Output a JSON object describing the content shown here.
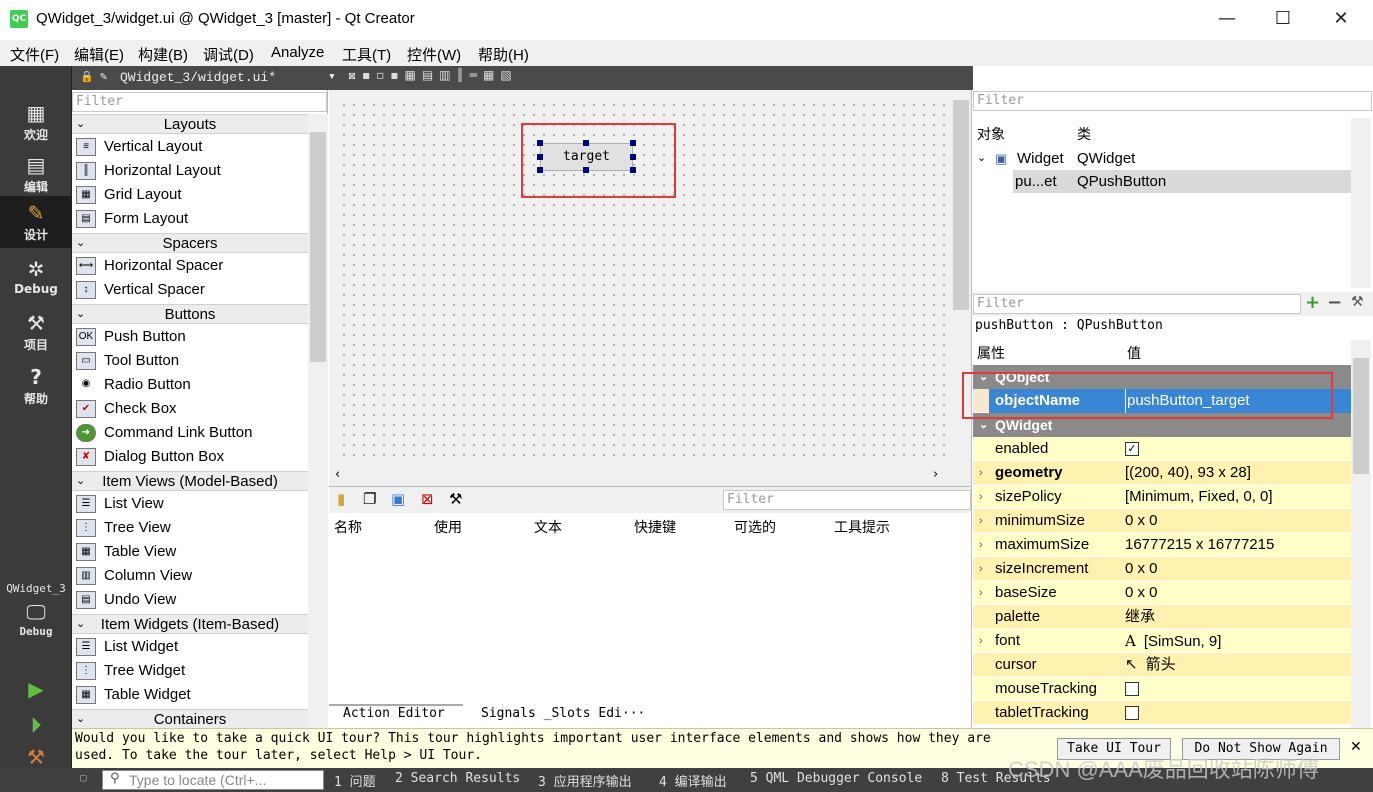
{
  "window": {
    "title": "QWidget_3/widget.ui @ QWidget_3 [master] - Qt Creator",
    "logo": "QC",
    "minimize": "—",
    "maximize": "☐",
    "close": "✕"
  },
  "menu": [
    "文件(F)",
    "编辑(E)",
    "构建(B)",
    "调试(D)",
    "Analyze",
    "工具(T)",
    "控件(W)",
    "帮助(H)"
  ],
  "modes": [
    {
      "label": "欢迎",
      "icon": "grid-icon"
    },
    {
      "label": "编辑",
      "icon": "document-icon"
    },
    {
      "label": "设计",
      "icon": "pencil-icon"
    },
    {
      "label": "Debug",
      "icon": "bug-icon"
    },
    {
      "label": "项目",
      "icon": "wrench-icon"
    },
    {
      "label": "帮助",
      "icon": "help-icon"
    }
  ],
  "kit": {
    "project": "QWidget_3",
    "config": "Debug"
  },
  "doc_tab": {
    "label": "QWidget_3/widget.ui*",
    "dropdown": "▾",
    "close": "✕"
  },
  "widget_box": {
    "filter_placeholder": "Filter",
    "categories": [
      {
        "name": "Layouts",
        "items": [
          "Vertical Layout",
          "Horizontal Layout",
          "Grid Layout",
          "Form Layout"
        ]
      },
      {
        "name": "Spacers",
        "items": [
          "Horizontal Spacer",
          "Vertical Spacer"
        ]
      },
      {
        "name": "Buttons",
        "items": [
          "Push Button",
          "Tool Button",
          "Radio Button",
          "Check Box",
          "Command Link Button",
          "Dialog Button Box"
        ]
      },
      {
        "name": "Item Views (Model-Based)",
        "items": [
          "List View",
          "Tree View",
          "Table View",
          "Column View",
          "Undo View"
        ]
      },
      {
        "name": "Item Widgets (Item-Based)",
        "items": [
          "List Widget",
          "Tree Widget",
          "Table Widget"
        ]
      },
      {
        "name": "Containers",
        "items": []
      }
    ]
  },
  "form": {
    "button_text": "target"
  },
  "action_editor": {
    "filter_placeholder": "Filter",
    "columns": [
      "名称",
      "使用",
      "文本",
      "快捷键",
      "可选的",
      "工具提示"
    ],
    "tabs": [
      "Action Editor",
      "Signals _Slots Edi···"
    ]
  },
  "object_inspector": {
    "filter_placeholder": "Filter",
    "headers": [
      "对象",
      "类"
    ],
    "rows": [
      {
        "object": "Widget",
        "class": "QWidget"
      },
      {
        "object": "pu...et",
        "class": "QPushButton"
      }
    ]
  },
  "property_editor": {
    "filter_placeholder": "Filter",
    "class_label": "pushButton : QPushButton",
    "headers": [
      "属性",
      "值"
    ],
    "groups": [
      {
        "name": "QObject",
        "props": [
          {
            "name": "objectName",
            "value": "pushButton_target",
            "bold": true
          }
        ]
      },
      {
        "name": "QWidget",
        "props": [
          {
            "name": "enabled",
            "value": "✓"
          },
          {
            "name": "geometry",
            "value": "[(200, 40), 93 x 28]",
            "bold": true
          },
          {
            "name": "sizePolicy",
            "value": "[Minimum, Fixed, 0, 0]"
          },
          {
            "name": "minimumSize",
            "value": "0 x 0"
          },
          {
            "name": "maximumSize",
            "value": "16777215 x 16777215"
          },
          {
            "name": "sizeIncrement",
            "value": "0 x 0"
          },
          {
            "name": "baseSize",
            "value": "0 x 0"
          },
          {
            "name": "palette",
            "value": "继承"
          },
          {
            "name": "font",
            "value": "[SimSun, 9]"
          },
          {
            "name": "cursor",
            "value": "箭头"
          },
          {
            "name": "mouseTracking",
            "value": ""
          },
          {
            "name": "tabletTracking",
            "value": ""
          }
        ]
      }
    ]
  },
  "tour": {
    "message_line1": "Would you like to take a quick UI tour? This tour highlights important user interface elements and shows how they are",
    "message_line2": "used. To take the tour later, select Help > UI Tour.",
    "take": "Take UI Tour",
    "dismiss": "Do Not Show Again",
    "close": "✕"
  },
  "status": {
    "locate_placeholder": "Type to locate (Ctrl+...",
    "panes": [
      "1 问题",
      "2 Search Results",
      "3 应用程序输出",
      "4 编译输出",
      "5 QML Debugger Console",
      "8 Test Results"
    ]
  },
  "watermark": "CSDN @AAA废品回收站陈师傅"
}
